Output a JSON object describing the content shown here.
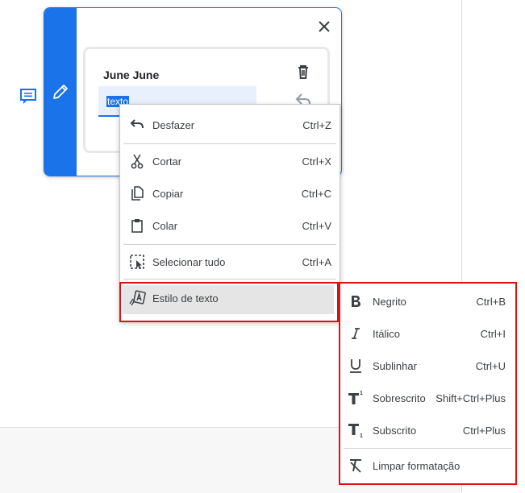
{
  "comment": {
    "author": "June June",
    "selected_text": "texto"
  },
  "context_menu": {
    "items": [
      {
        "label": "Desfazer",
        "shortcut": "Ctrl+Z",
        "icon": "undo-icon"
      },
      {
        "label": "Cortar",
        "shortcut": "Ctrl+X",
        "icon": "scissors-icon"
      },
      {
        "label": "Copiar",
        "shortcut": "Ctrl+C",
        "icon": "copy-icon"
      },
      {
        "label": "Colar",
        "shortcut": "Ctrl+V",
        "icon": "paste-icon"
      },
      {
        "label": "Selecionar tudo",
        "shortcut": "Ctrl+A",
        "icon": "select-all-icon"
      },
      {
        "label": "Estilo de texto",
        "shortcut": "",
        "icon": "text-style-icon"
      }
    ]
  },
  "text_style_submenu": {
    "items": [
      {
        "label": "Negrito",
        "shortcut": "Ctrl+B",
        "icon": "bold-icon"
      },
      {
        "label": "Itálico",
        "shortcut": "Ctrl+I",
        "icon": "italic-icon"
      },
      {
        "label": "Sublinhar",
        "shortcut": "Ctrl+U",
        "icon": "underline-icon"
      },
      {
        "label": "Sobrescrito",
        "shortcut": "Shift+Ctrl+Plus",
        "icon": "superscript-icon"
      },
      {
        "label": "Subscrito",
        "shortcut": "Ctrl+Plus",
        "icon": "subscript-icon"
      },
      {
        "label": "Limpar formatação",
        "shortcut": "",
        "icon": "clear-formatting-icon"
      }
    ]
  },
  "colors": {
    "accent": "#1a73e8",
    "highlight_border": "#e01010",
    "hover": "#e5e5e5"
  }
}
